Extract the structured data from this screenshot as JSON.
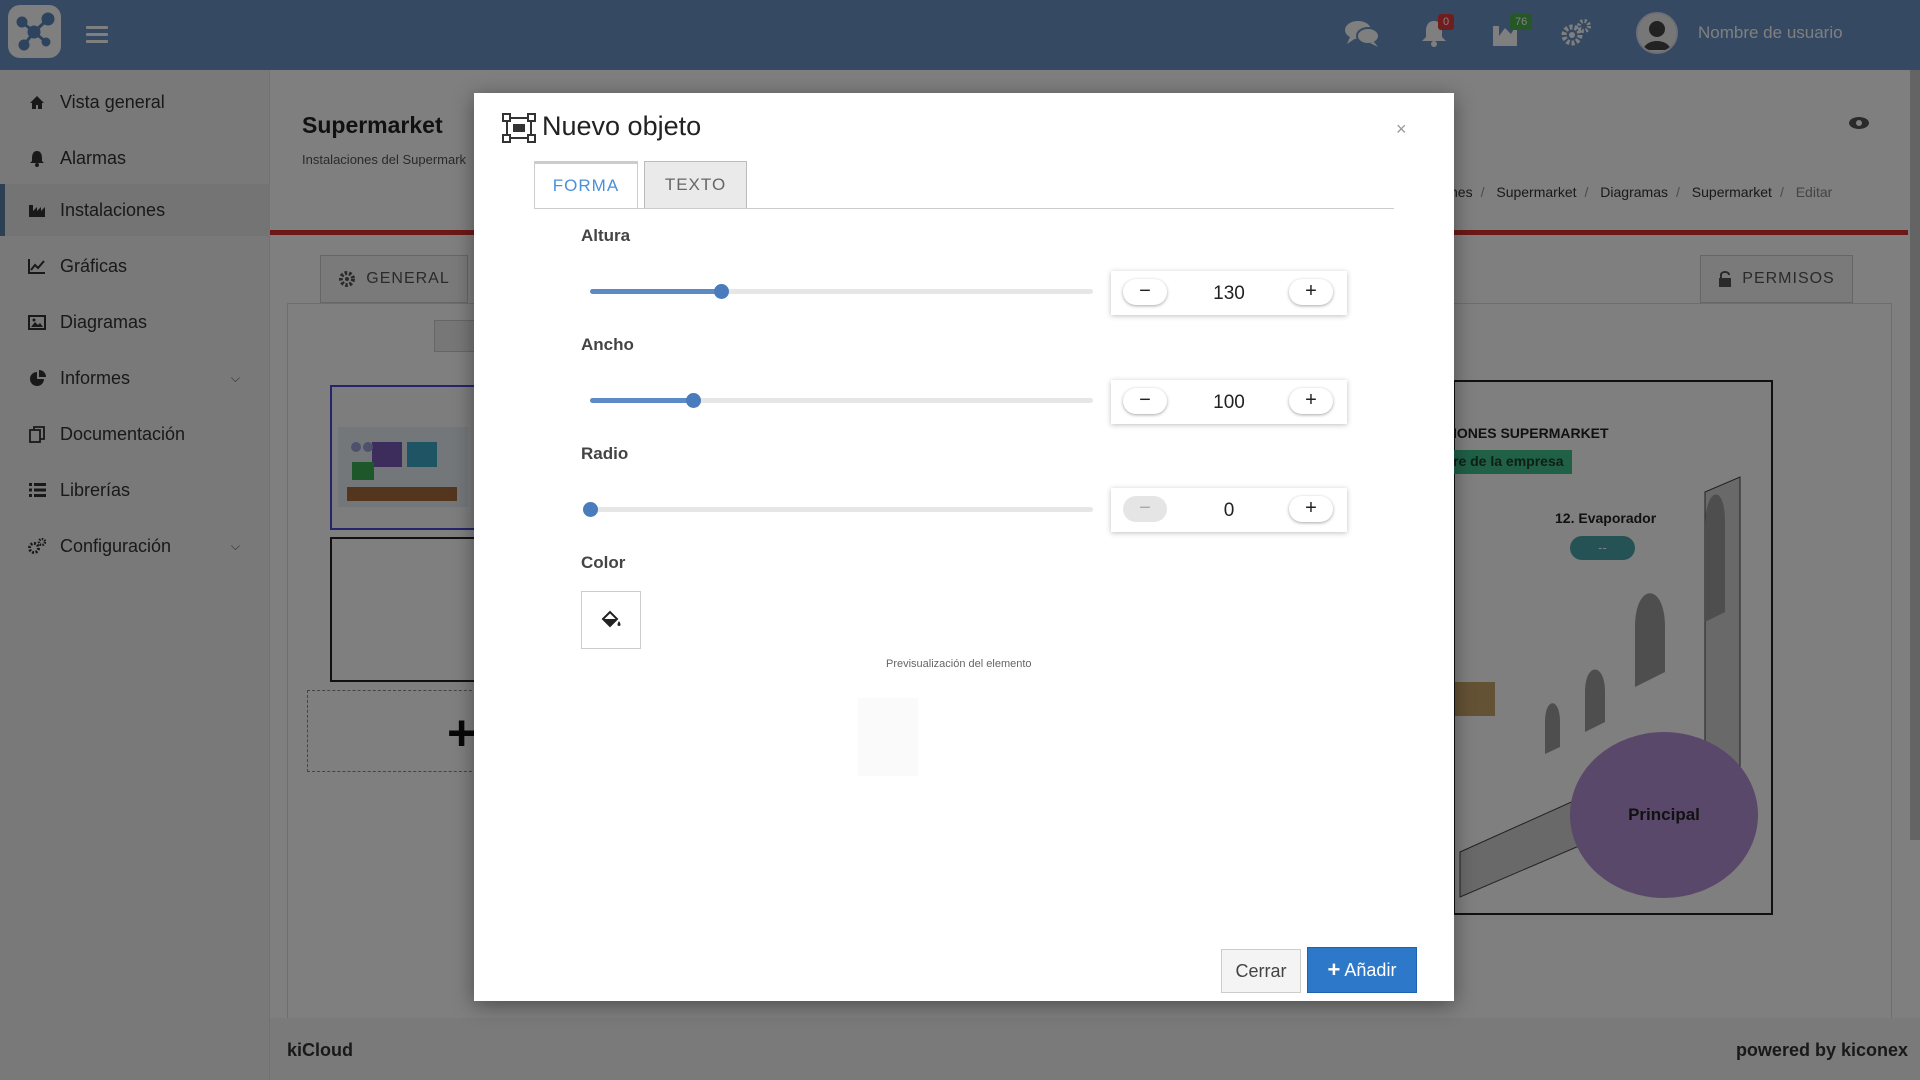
{
  "app": {
    "user_name": "Nombre de usuario",
    "notifications_count": "0",
    "tasks_count": "76",
    "brand_color": "#6a95c4"
  },
  "sidebar": {
    "items": [
      {
        "label": "Vista general",
        "icon": "home-icon"
      },
      {
        "label": "Alarmas",
        "icon": "bell-icon"
      },
      {
        "label": "Instalaciones",
        "icon": "building-icon",
        "active": true
      },
      {
        "label": "Gráficas",
        "icon": "line-chart-icon"
      },
      {
        "label": "Diagramas",
        "icon": "image-icon"
      },
      {
        "label": "Informes",
        "icon": "pie-chart-icon",
        "expandable": true
      },
      {
        "label": "Documentación",
        "icon": "copy-icon"
      },
      {
        "label": "Librerías",
        "icon": "list-icon"
      },
      {
        "label": "Configuración",
        "icon": "gears-icon",
        "expandable": true
      }
    ]
  },
  "page": {
    "title": "Supermarket",
    "subtitle": "Instalaciones del Supermark",
    "breadcrumb": [
      "nes",
      "Supermarket",
      "Diagramas",
      "Supermarket",
      "Editar"
    ],
    "tab_general": "GENERAL",
    "tab_permisos": "PERMISOS",
    "diagram": {
      "title": "IONES SUPERMARKET",
      "company": "re de la empresa",
      "evaporator": "12. Evaporador",
      "evaporator_value": "--",
      "circle_label": "Principal"
    }
  },
  "footer": {
    "left": "kiCloud",
    "right": "powered by kiconex"
  },
  "modal": {
    "title": "Nuevo objeto",
    "close": "×",
    "tabs": [
      {
        "label": "FORMA",
        "active": true
      },
      {
        "label": "TEXTO",
        "active": false
      }
    ],
    "fields": {
      "altura": {
        "label": "Altura",
        "value": "130",
        "slider_fraction": 0.26
      },
      "ancho": {
        "label": "Ancho",
        "value": "100",
        "slider_fraction": 0.205
      },
      "radio": {
        "label": "Radio",
        "value": "0",
        "slider_fraction": 0.0
      }
    },
    "color_label": "Color",
    "preview_label": "Previsualización del elemento",
    "buttons": {
      "cancel": "Cerrar",
      "add": "Añadir"
    },
    "accent_color": "#2d78c8"
  }
}
